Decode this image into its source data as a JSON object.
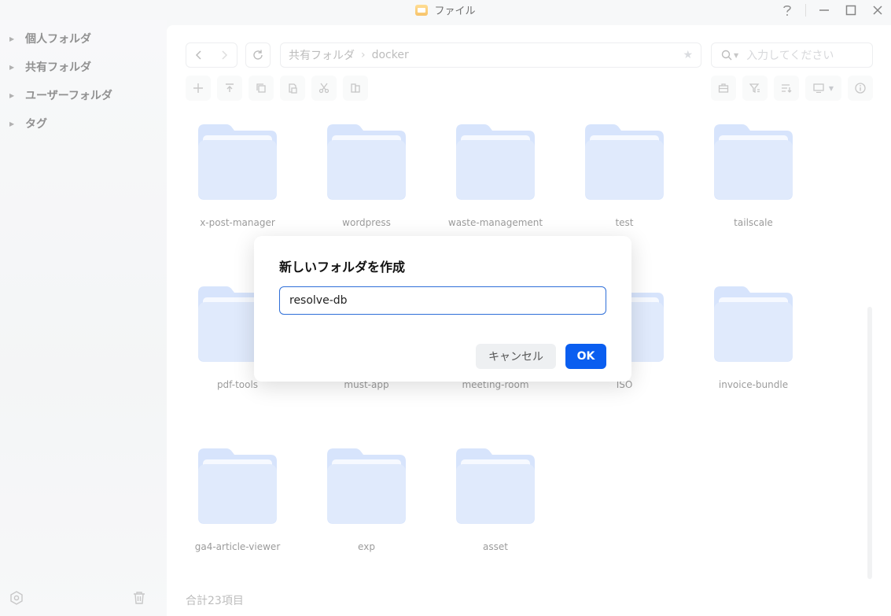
{
  "window": {
    "title": "ファイル"
  },
  "sidebar": {
    "items": [
      {
        "label": "個人フォルダ"
      },
      {
        "label": "共有フォルダ"
      },
      {
        "label": "ユーザーフォルダ"
      },
      {
        "label": "タグ"
      }
    ]
  },
  "breadcrumb": {
    "root": "共有フォルダ",
    "current": "docker"
  },
  "search": {
    "placeholder": "入力してください"
  },
  "folders": [
    "x-post-manager",
    "wordpress",
    "waste-management",
    "test",
    "tailscale",
    "pdf-tools",
    "must-app",
    "meeting-room",
    "ISO",
    "invoice-bundle",
    "ga4-article-viewer",
    "exp",
    "asset"
  ],
  "footer": {
    "count": "合計23項目"
  },
  "dialog": {
    "title": "新しいフォルダを作成",
    "input_value": "resolve-db",
    "cancel_label": "キャンセル",
    "ok_label": "OK"
  },
  "colors": {
    "accent": "#0a5ef0",
    "folder": "#cfdffb"
  }
}
